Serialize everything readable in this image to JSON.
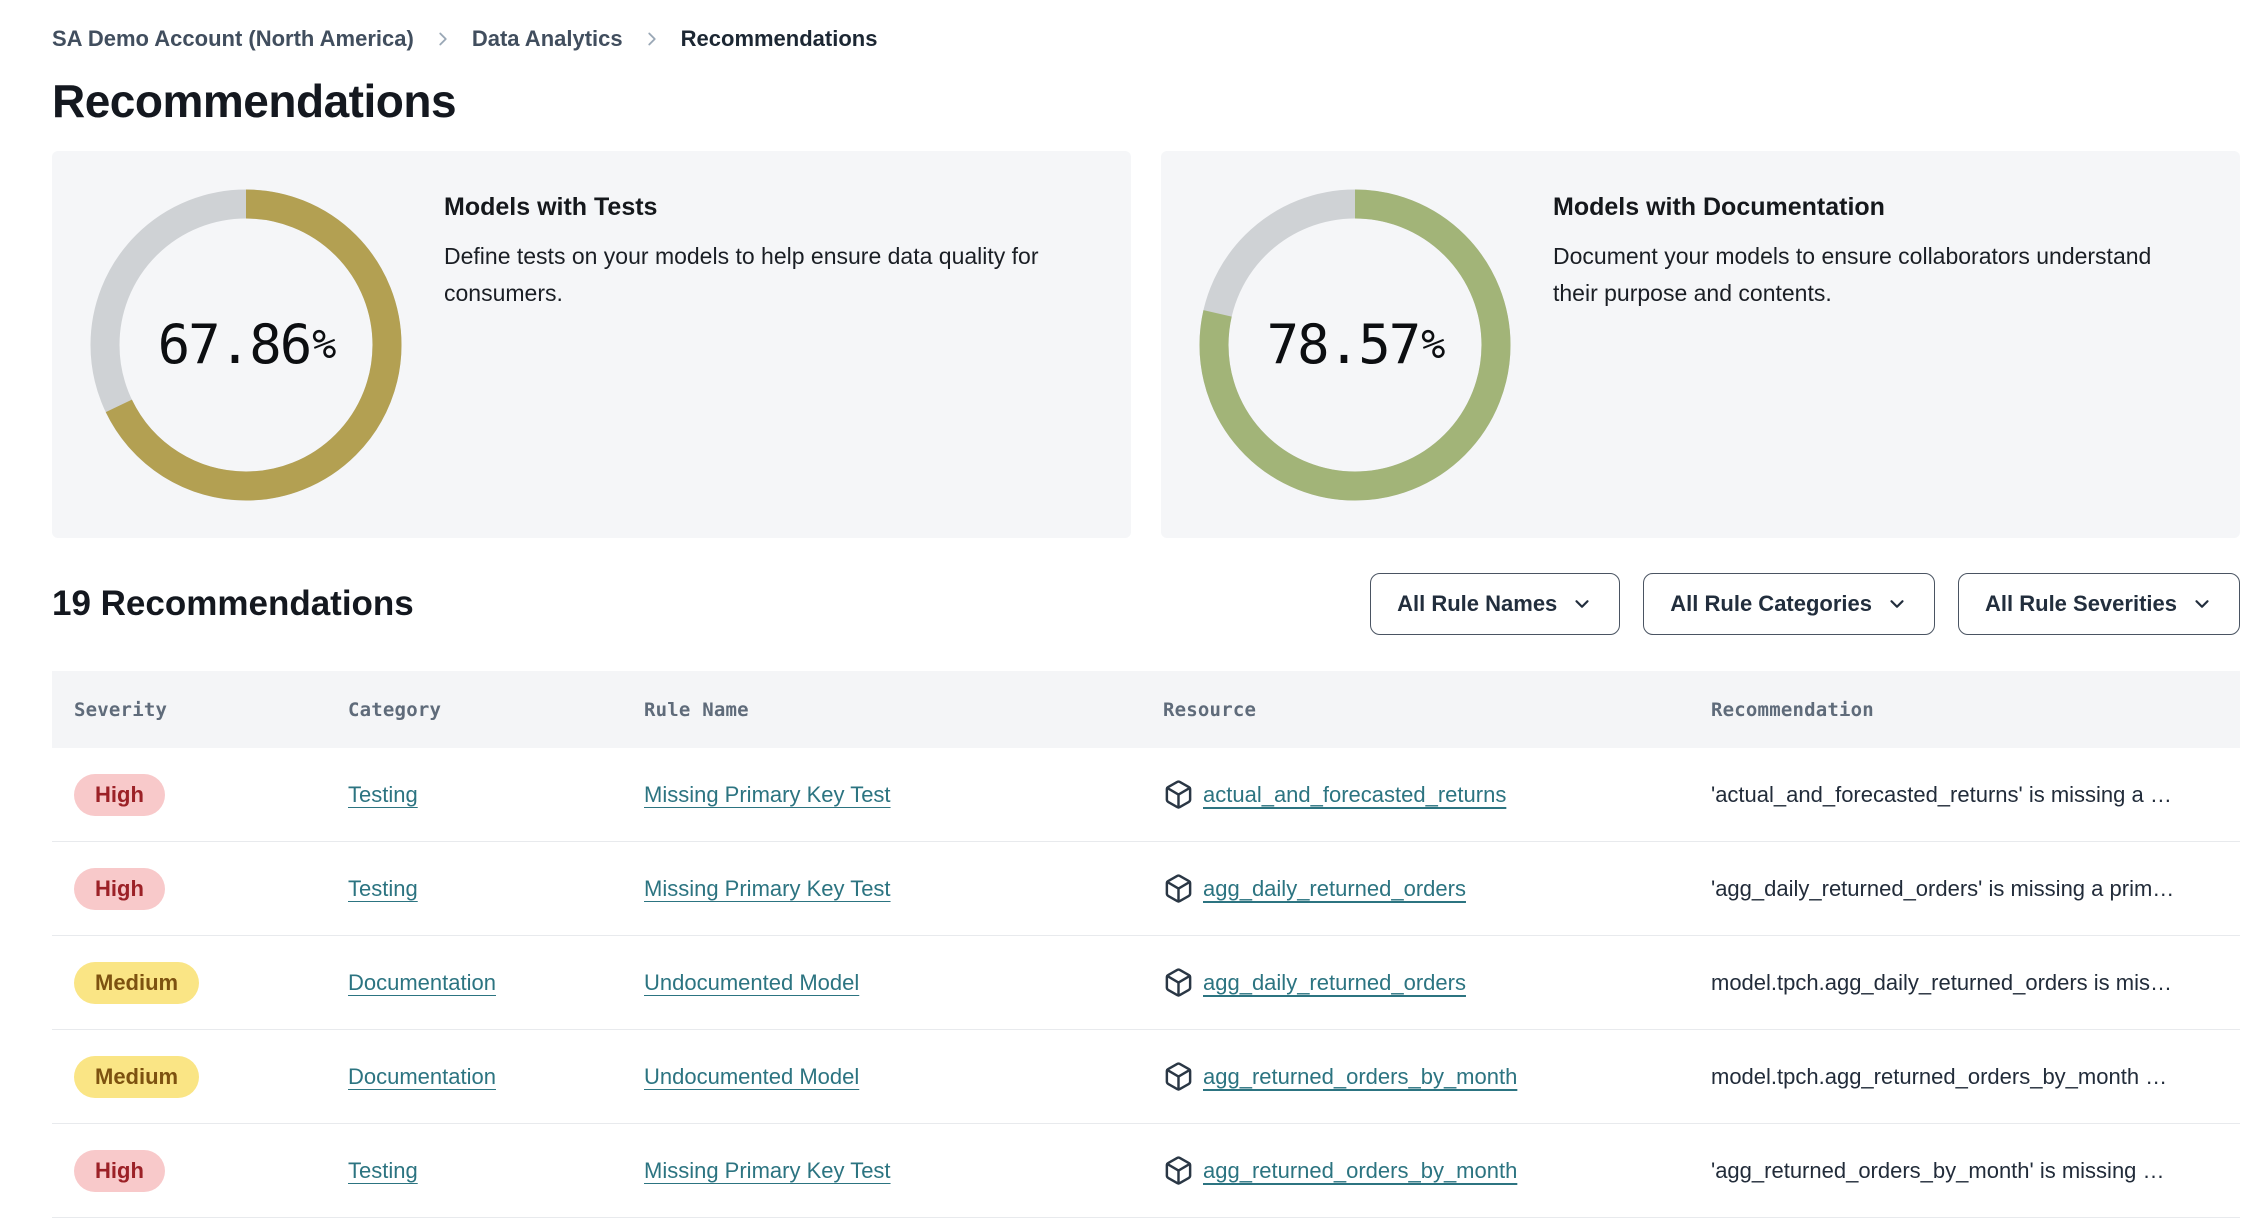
{
  "breadcrumb": {
    "items": [
      "SA Demo Account (North America)",
      "Data Analytics"
    ],
    "current": "Recommendations"
  },
  "page_title": "Recommendations",
  "cards": [
    {
      "title": "Models with Tests",
      "description": "Define tests on your models to help ensure data quality for consumers.",
      "percent_value": 67.86,
      "percent_label": "67.86",
      "percent_sign": "%",
      "arc_color": "#b3a052",
      "track_color": "#cfd2d5"
    },
    {
      "title": "Models with Documentation",
      "description": "Document your models to ensure collaborators understand their purpose and contents.",
      "percent_value": 78.57,
      "percent_label": "78.57",
      "percent_sign": "%",
      "arc_color": "#a2b478",
      "track_color": "#cfd2d5"
    }
  ],
  "list_header": {
    "title": "19 Recommendations",
    "filters": [
      {
        "label": "All Rule Names"
      },
      {
        "label": "All Rule Categories"
      },
      {
        "label": "All Rule Severities"
      }
    ]
  },
  "table": {
    "columns": [
      "Severity",
      "Category",
      "Rule Name",
      "Resource",
      "Recommendation"
    ],
    "rows": [
      {
        "severity": "High",
        "category": "Testing",
        "rule_name": "Missing Primary Key Test",
        "resource": "actual_and_forecasted_returns",
        "recommendation": "'actual_and_forecasted_returns' is missing a …"
      },
      {
        "severity": "High",
        "category": "Testing",
        "rule_name": "Missing Primary Key Test",
        "resource": "agg_daily_returned_orders",
        "recommendation": "'agg_daily_returned_orders' is missing a prim…"
      },
      {
        "severity": "Medium",
        "category": "Documentation",
        "rule_name": "Undocumented Model",
        "resource": "agg_daily_returned_orders",
        "recommendation": "model.tpch.agg_daily_returned_orders is mis…"
      },
      {
        "severity": "Medium",
        "category": "Documentation",
        "rule_name": "Undocumented Model",
        "resource": "agg_returned_orders_by_month",
        "recommendation": "model.tpch.agg_returned_orders_by_month …"
      },
      {
        "severity": "High",
        "category": "Testing",
        "rule_name": "Missing Primary Key Test",
        "resource": "agg_returned_orders_by_month",
        "recommendation": "'agg_returned_orders_by_month' is missing …"
      }
    ]
  }
}
